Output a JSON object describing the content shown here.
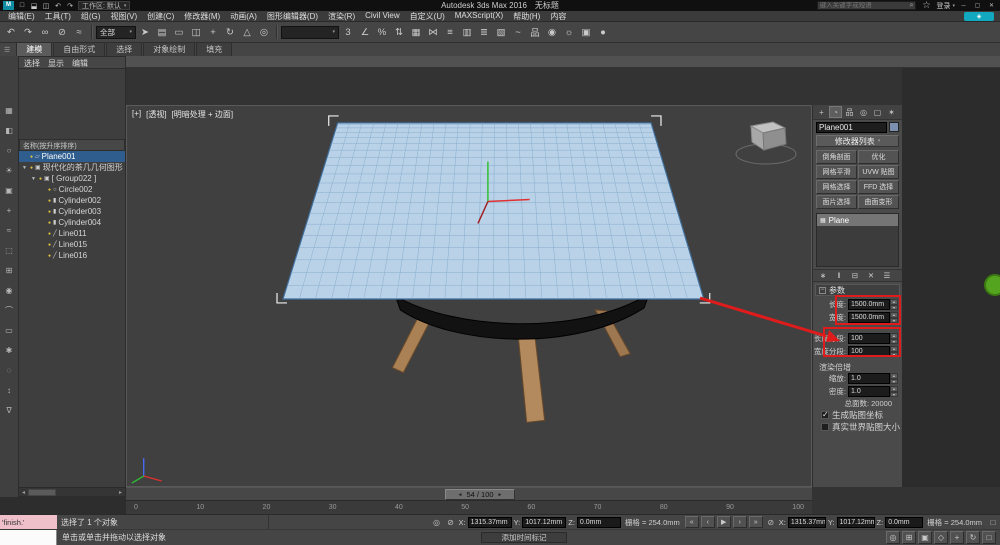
{
  "colors": {
    "accent_red": "#e01b1b",
    "selection_blue": "#2e5d8e",
    "plane_fill": "#b9d2e8",
    "plane_grid": "#7fa6c9",
    "leg_tan": "#a98155",
    "badge_cyan": "#12a9c0",
    "floating_green": "#55a41f"
  },
  "glyphs": {
    "caret_down": "▾",
    "spinner_up": "▴",
    "spinner_down": "▾",
    "minus": "−"
  },
  "titlebar": {
    "logo": "M",
    "app_title": "Autodesk 3ds Max 2016",
    "doc_title": "无标题",
    "workspace": "工作区: 默认",
    "qat_icons": [
      {
        "name": "new-file-icon",
        "glyph": "□"
      },
      {
        "name": "open-file-icon",
        "glyph": "⬓"
      },
      {
        "name": "save-file-icon",
        "glyph": "◫"
      },
      {
        "name": "undo-icon",
        "glyph": "↶"
      },
      {
        "name": "redo-icon",
        "glyph": "↷"
      }
    ],
    "window_min": "─",
    "window_max": "▢",
    "window_close": "✕"
  },
  "infocenter": {
    "search_placeholder": "键入关键字或短语",
    "search_icon": "⌕",
    "star_icon": "☆",
    "signin_label": "登录",
    "comm_icon": "◈"
  },
  "menubar": {
    "items": [
      {
        "label": "编辑(E)"
      },
      {
        "label": "工具(T)"
      },
      {
        "label": "组(G)"
      },
      {
        "label": "视图(V)"
      },
      {
        "label": "创建(C)"
      },
      {
        "label": "修改器(M)"
      },
      {
        "label": "动画(A)"
      },
      {
        "label": "图形编辑器(D)"
      },
      {
        "label": "渲染(R)"
      },
      {
        "label": "Civil View"
      },
      {
        "label": "自定义(U)"
      },
      {
        "label": "MAXScript(X)"
      },
      {
        "label": "帮助(H)"
      },
      {
        "label": "内容"
      }
    ]
  },
  "toolbar": {
    "group1": [
      {
        "name": "undo-icon",
        "glyph": "↶"
      },
      {
        "name": "redo-icon",
        "glyph": "↷"
      },
      {
        "name": "select-and-link-icon",
        "glyph": "∞"
      },
      {
        "name": "unlink-selection-icon",
        "glyph": "⊘"
      },
      {
        "name": "bind-to-space-warp-icon",
        "glyph": "≈"
      }
    ],
    "filter_value": "全部",
    "group2": [
      {
        "name": "select-object-icon",
        "glyph": "➤"
      },
      {
        "name": "select-by-name-icon",
        "glyph": "▤"
      },
      {
        "name": "rectangular-selection-icon",
        "glyph": "▭"
      },
      {
        "name": "window-crossing-icon",
        "glyph": "◫"
      },
      {
        "name": "select-and-move-icon",
        "glyph": "+"
      },
      {
        "name": "select-and-rotate-icon",
        "glyph": "↻"
      },
      {
        "name": "select-and-scale-icon",
        "glyph": "△"
      },
      {
        "name": "pivot-center-icon",
        "glyph": "◎"
      }
    ],
    "named_sets_value": "",
    "group3": [
      {
        "name": "snap-toggle-icon",
        "glyph": "3"
      },
      {
        "name": "angle-snap-icon",
        "glyph": "∠"
      },
      {
        "name": "percent-snap-icon",
        "glyph": "%"
      },
      {
        "name": "spinner-snap-icon",
        "glyph": "⇅"
      },
      {
        "name": "edit-named-selections-icon",
        "glyph": "▦"
      },
      {
        "name": "mirror-icon",
        "glyph": "⋈"
      },
      {
        "name": "align-icon",
        "glyph": "≡"
      },
      {
        "name": "scene-explorer-toggle-icon",
        "glyph": "▥"
      },
      {
        "name": "layer-manager-icon",
        "glyph": "≣"
      },
      {
        "name": "ribbon-toggle-icon",
        "glyph": "▧"
      },
      {
        "name": "curve-editor-icon",
        "glyph": "~"
      },
      {
        "name": "schematic-view-icon",
        "glyph": "品"
      },
      {
        "name": "material-editor-icon",
        "glyph": "◉"
      },
      {
        "name": "render-setup-icon",
        "glyph": "☼"
      },
      {
        "name": "rendered-frame-icon",
        "glyph": "▣"
      },
      {
        "name": "render-production-icon",
        "glyph": "●"
      }
    ]
  },
  "ribbon": {
    "grip_icon": "☰",
    "tabs": [
      {
        "label": "建模",
        "active": true
      },
      {
        "label": "自由形式"
      },
      {
        "label": "选择"
      },
      {
        "label": "对象绘制"
      },
      {
        "label": "填充"
      }
    ]
  },
  "explorer": {
    "menu": [
      {
        "label": "选择"
      },
      {
        "label": "显示"
      },
      {
        "label": "编辑"
      }
    ],
    "name_header": "名称(按升序排序)",
    "side_icons": [
      {
        "name": "explorer-tools-icon",
        "glyph": "▦"
      },
      {
        "name": "display-geometry-icon",
        "glyph": "◧"
      },
      {
        "name": "display-shapes-icon",
        "glyph": "○"
      },
      {
        "name": "display-lights-icon",
        "glyph": "☀"
      },
      {
        "name": "display-cameras-icon",
        "glyph": "▣"
      },
      {
        "name": "display-helpers-icon",
        "glyph": "+"
      },
      {
        "name": "display-spacewarps-icon",
        "glyph": "≈"
      },
      {
        "name": "display-groups-icon",
        "glyph": "⬚"
      },
      {
        "name": "display-xrefs-icon",
        "glyph": "⊞"
      },
      {
        "name": "display-materials-icon",
        "glyph": "◉"
      },
      {
        "name": "display-bones-icon",
        "glyph": "⌒"
      },
      {
        "name": "display-containers-icon",
        "glyph": "▭"
      },
      {
        "name": "display-frozen-icon",
        "glyph": "✱"
      },
      {
        "name": "display-hidden-icon",
        "glyph": "◌"
      },
      {
        "name": "sort-mode-icon",
        "glyph": "↕"
      },
      {
        "name": "filter-icon",
        "glyph": "∇"
      }
    ],
    "rows": [
      {
        "name": "Plane001",
        "type_glyph": "▱",
        "bulb": "●",
        "selected": true,
        "indent": 0,
        "arrow": ""
      },
      {
        "name": "现代化的茶几几何图形",
        "type_glyph": "▣",
        "bulb": "●",
        "indent": 0,
        "arrow": "▼"
      },
      {
        "name": "[ Group022 ]",
        "type_glyph": "▣",
        "bulb": "●",
        "indent": 1,
        "arrow": "▼"
      },
      {
        "name": "Circle002",
        "type_glyph": "○",
        "bulb": "●",
        "indent": 2,
        "arrow": ""
      },
      {
        "name": "Cylinder002",
        "type_glyph": "▮",
        "bulb": "●",
        "indent": 2,
        "arrow": ""
      },
      {
        "name": "Cylinder003",
        "type_glyph": "▮",
        "bulb": "●",
        "indent": 2,
        "arrow": ""
      },
      {
        "name": "Cylinder004",
        "type_glyph": "▮",
        "bulb": "●",
        "indent": 2,
        "arrow": ""
      },
      {
        "name": "Line011",
        "type_glyph": "╱",
        "bulb": "●",
        "indent": 2,
        "arrow": ""
      },
      {
        "name": "Line015",
        "type_glyph": "╱",
        "bulb": "●",
        "indent": 2,
        "arrow": ""
      },
      {
        "name": "Line016",
        "type_glyph": "╱",
        "bulb": "●",
        "indent": 2,
        "arrow": ""
      }
    ],
    "hscroll_left": "◂",
    "hscroll_right": "▸"
  },
  "viewport": {
    "label_general": "[+]",
    "label_pov": "[透视]",
    "label_shading": "[明暗处理 + 边面]"
  },
  "timeline": {
    "slider_label": "54 / 100",
    "ticks": [
      "0",
      "10",
      "20",
      "30",
      "40",
      "50",
      "60",
      "70",
      "80",
      "90",
      "100"
    ]
  },
  "statusbar": {
    "macro_text": "'finish.'",
    "status_text": "选择了 1 个对象",
    "prompt_text": "单击或单击并拖动以选择对象",
    "time_tag_label": "添加时间标记",
    "isolate_icon": "◎",
    "lock_icon": "⊘",
    "x_label": "X:",
    "y_label": "Y:",
    "z_label": "Z:",
    "x_value": "1315.37mm",
    "y_value": "1017.12mm",
    "z_value": "0.0mm",
    "grid_text": "栅格 = 254.0mm",
    "playback": [
      {
        "name": "go-to-start-icon",
        "glyph": "«"
      },
      {
        "name": "previous-frame-icon",
        "glyph": "‹"
      },
      {
        "name": "play-icon",
        "glyph": "▶"
      },
      {
        "name": "next-frame-icon",
        "glyph": "›"
      },
      {
        "name": "go-to-end-icon",
        "glyph": "»"
      }
    ],
    "nav": [
      {
        "name": "zoom-icon",
        "glyph": "◎"
      },
      {
        "name": "zoom-all-icon",
        "glyph": "⊞"
      },
      {
        "name": "zoom-extents-icon",
        "glyph": "▣"
      },
      {
        "name": "field-of-view-icon",
        "glyph": "◇"
      },
      {
        "name": "pan-icon",
        "glyph": "+"
      },
      {
        "name": "orbit-icon",
        "glyph": "↻"
      },
      {
        "name": "maximize-viewport-icon",
        "glyph": "□"
      }
    ]
  },
  "cmdpanel": {
    "tabs": [
      {
        "name": "create-tab-icon",
        "glyph": "+"
      },
      {
        "name": "modify-tab-icon",
        "glyph": "◔",
        "active": true
      },
      {
        "name": "hierarchy-tab-icon",
        "glyph": "品"
      },
      {
        "name": "motion-tab-icon",
        "glyph": "◎"
      },
      {
        "name": "display-tab-icon",
        "glyph": "▢"
      },
      {
        "name": "utilities-tab-icon",
        "glyph": "✶"
      }
    ],
    "object_name": "Plane001",
    "modifier_list_label": "修改器列表",
    "modifier_buttons": [
      {
        "label": "倒角剖面"
      },
      {
        "label": "优化"
      },
      {
        "label": "网格平滑"
      },
      {
        "label": "UVW 贴图"
      },
      {
        "label": "网格选择"
      },
      {
        "label": "FFD 选择"
      },
      {
        "label": "面片选择"
      },
      {
        "label": "曲面变形"
      }
    ],
    "stack_items": [
      {
        "icon": "▦",
        "label": "Plane",
        "selected": true
      }
    ],
    "stack_tools": [
      {
        "name": "pin-stack-icon",
        "glyph": "∗"
      },
      {
        "name": "show-end-result-icon",
        "glyph": "‖"
      },
      {
        "name": "make-unique-icon",
        "glyph": "⊟"
      },
      {
        "name": "remove-modifier-icon",
        "glyph": "✕"
      },
      {
        "name": "configure-modifier-sets-icon",
        "glyph": "☰"
      }
    ],
    "rollout_title": "参数",
    "dim_params": [
      {
        "label": "长度:",
        "value": "1500.0mm"
      },
      {
        "label": "宽度:",
        "value": "1500.0mm"
      }
    ],
    "seg_params": [
      {
        "label": "长度分段:",
        "value": "100"
      },
      {
        "label": "宽度分段:",
        "value": "100"
      }
    ],
    "render_group_label": "渲染倍增",
    "render_params": [
      {
        "label": "缩放:",
        "value": "1.0"
      },
      {
        "label": "密度:",
        "value": "1.0"
      }
    ],
    "total_faces_label": "总面数: 20000",
    "checkboxes": [
      {
        "label": "生成贴图坐标",
        "checked": true
      },
      {
        "label": "真实世界贴图大小",
        "checked": false
      }
    ]
  }
}
